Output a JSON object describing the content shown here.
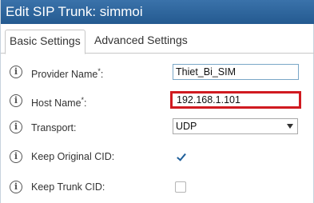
{
  "dialog": {
    "title": "Edit SIP Trunk: simmoi"
  },
  "tabs": [
    {
      "label": "Basic Settings",
      "active": true
    },
    {
      "label": "Advanced Settings",
      "active": false
    }
  ],
  "fields": {
    "provider_name": {
      "label": "Provider Name",
      "required_mark": "*",
      "suffix": ":",
      "value": "Thiet_Bi_SIM"
    },
    "host_name": {
      "label": "Host Name",
      "required_mark": "*",
      "suffix": ":",
      "value": "192.168.1.101"
    },
    "transport": {
      "label": "Transport:",
      "value": "UDP"
    },
    "keep_original_cid": {
      "label": "Keep Original CID:",
      "checked": true
    },
    "keep_trunk_cid": {
      "label": "Keep Trunk CID:",
      "checked": false
    }
  },
  "icons": {
    "info_glyph": "i"
  },
  "colors": {
    "titlebar": "#2e6398",
    "highlight_border": "#d01a20",
    "check_mark": "#1f5f9a"
  }
}
